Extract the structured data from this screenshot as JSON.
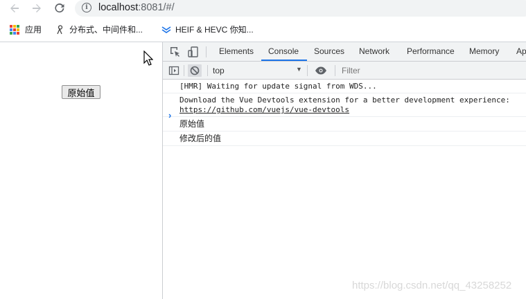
{
  "browser": {
    "url_host": "localhost",
    "url_rest": ":8081/#/",
    "bookmarks": [
      {
        "label": "应用",
        "icon": "apps-grid-icon"
      },
      {
        "label": "分布式、中间件和...",
        "icon": "person-icon"
      },
      {
        "label": "HEIF & HEVC 你知...",
        "icon": "chevron-double-icon"
      }
    ]
  },
  "page": {
    "button_label": "原始值"
  },
  "devtools": {
    "tabs": [
      "Elements",
      "Console",
      "Sources",
      "Network",
      "Performance",
      "Memory",
      "Ap"
    ],
    "active_tab": "Console",
    "context": "top",
    "filter_placeholder": "Filter",
    "messages": [
      {
        "line1": "[HMR] Waiting for update signal from WDS..."
      },
      {
        "line1": "Download the Vue Devtools extension for a better development experience:",
        "link": "https://github.com/vuejs/vue-devtools"
      },
      {
        "line1": "原始值"
      },
      {
        "line1": "修改后的值"
      }
    ],
    "prompt": "›"
  },
  "watermark": "https://blog.csdn.net/qq_43258252",
  "colors": {
    "accent": "#1a73e8",
    "toolbar_bg": "#f1f3f4"
  }
}
